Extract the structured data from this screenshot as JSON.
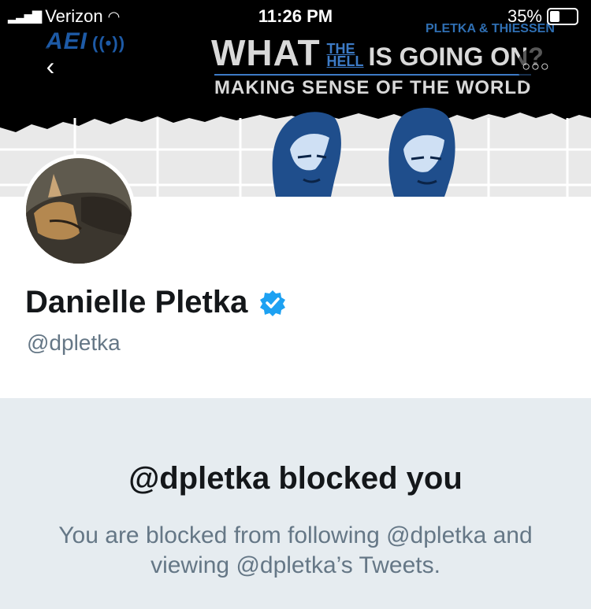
{
  "status_bar": {
    "carrier": "Verizon",
    "time": "11:26 PM",
    "battery": "35%"
  },
  "banner": {
    "logo": "AEI",
    "authors": "PLETKA & THIESSEN",
    "headline_what": "WHAT",
    "headline_the": "THE",
    "headline_hell": "HELL",
    "headline_rest": "IS GOING ON?",
    "subtitle": "MAKING SENSE OF THE WORLD"
  },
  "nav": {
    "back_icon": "chevron-left-icon",
    "more_icon": "more-horizontal-icon"
  },
  "profile": {
    "name": "Danielle Pletka",
    "handle": "@dpletka",
    "verified_color": "#1da1f2"
  },
  "blocked": {
    "title": "@dpletka blocked you",
    "body": "You are blocked from following @dpletka and viewing @dpletka’s Tweets."
  },
  "colors": {
    "accent": "#1da1f2",
    "brand_blue": "#1d5aa6",
    "muted_text": "#657786"
  }
}
